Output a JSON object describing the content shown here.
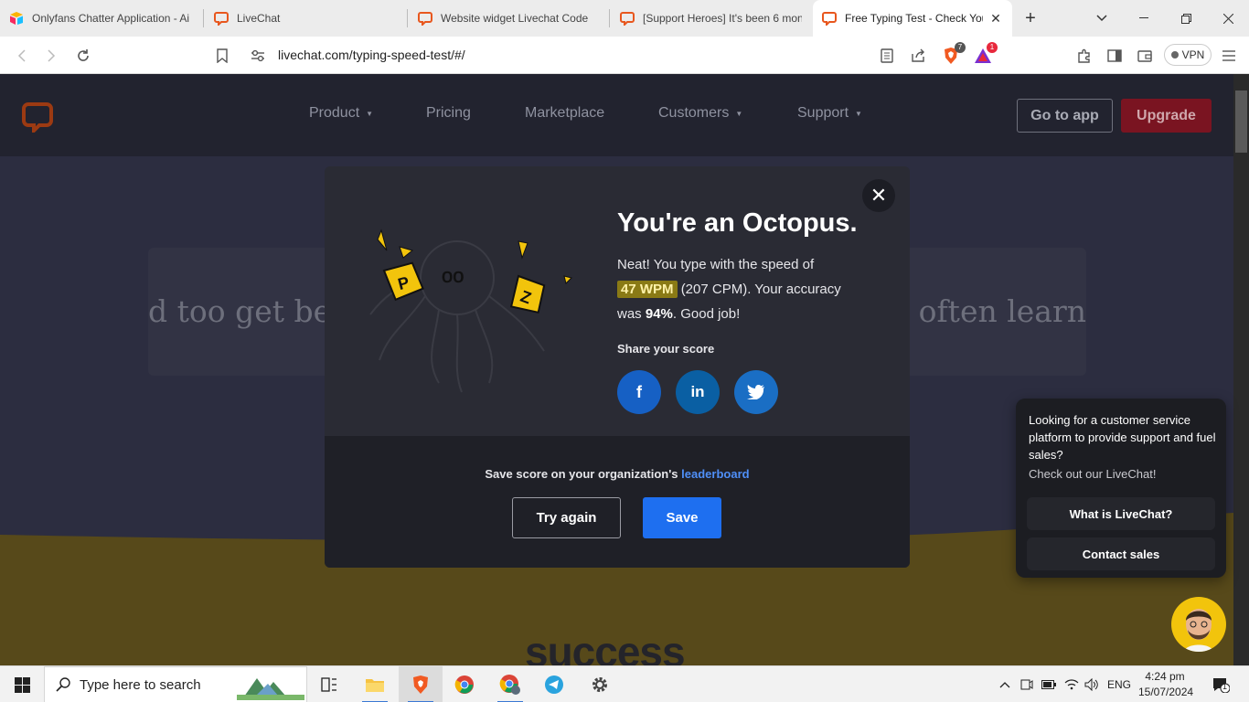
{
  "browser": {
    "tabs": [
      {
        "title": "Onlyfans Chatter Application - Ai",
        "icon": "airtable-icon"
      },
      {
        "title": "LiveChat",
        "icon": "livechat-icon"
      },
      {
        "title": "Website widget Livechat Code",
        "icon": "livechat-icon"
      },
      {
        "title": "[Support Heroes] It's been 6 mon",
        "icon": "livechat-icon"
      },
      {
        "title": "Free Typing Test - Check You",
        "icon": "livechat-icon",
        "active": true
      }
    ],
    "url": "livechat.com/typing-speed-test/#/",
    "vpn_label": "VPN",
    "brave_badge": "7",
    "rewards_badge": "1"
  },
  "site": {
    "nav": [
      {
        "label": "Product",
        "dropdown": true
      },
      {
        "label": "Pricing",
        "dropdown": false
      },
      {
        "label": "Marketplace",
        "dropdown": false
      },
      {
        "label": "Customers",
        "dropdown": true
      },
      {
        "label": "Support",
        "dropdown": true
      }
    ],
    "go_to_app": "Go to app",
    "upgrade": "Upgrade",
    "typing_left": "d too get befo",
    "typing_right": "ep often learn",
    "footer_heading": "success"
  },
  "modal": {
    "title": "You're an Octopus.",
    "text_before": "Neat! You type with the speed of",
    "wpm": "47 WPM",
    "cpm": "(207 CPM). Your accuracy",
    "was": "was",
    "accuracy": "94%",
    "text_after": ". Good job!",
    "share_label": "Share your score",
    "share": [
      {
        "name": "facebook",
        "glyph": "f",
        "color": "#1660c4"
      },
      {
        "name": "linkedin",
        "glyph": "in",
        "color": "#0a5fa3"
      },
      {
        "name": "twitter",
        "glyph": "🐦",
        "color": "#1a6ec4"
      }
    ],
    "save_prefix": "Save score on your organization's",
    "save_link": "leaderboard",
    "try_again": "Try again",
    "save": "Save"
  },
  "chat": {
    "message": "Looking for a customer service platform to provide support and fuel sales?",
    "sub": "Check out our LiveChat!",
    "btn_what": "What is LiveChat?",
    "btn_contact": "Contact sales"
  },
  "taskbar": {
    "search_placeholder": "Type here to search",
    "language": "ENG",
    "time": "4:24 pm",
    "date": "15/07/2024",
    "notification_count": "1"
  },
  "colors": {
    "accent_orange": "#e8571e",
    "modal_bg": "#2a2b34",
    "save_blue": "#1e6ff0",
    "upgrade_red": "#7a1421",
    "wave_gold": "#57491a"
  }
}
